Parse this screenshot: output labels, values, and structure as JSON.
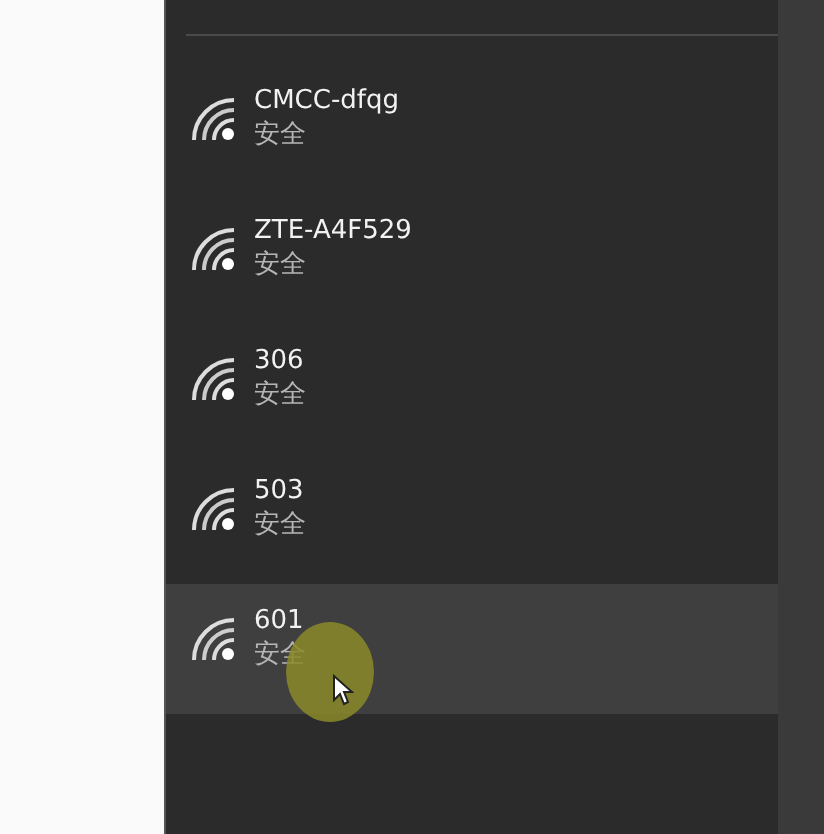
{
  "networks": [
    {
      "name": "CMCC-dfqg",
      "status": "安全",
      "selected": false
    },
    {
      "name": "ZTE-A4F529",
      "status": "安全",
      "selected": false
    },
    {
      "name": "306",
      "status": "安全",
      "selected": false
    },
    {
      "name": "503",
      "status": "安全",
      "selected": false
    },
    {
      "name": "601",
      "status": "安全",
      "selected": true
    }
  ]
}
